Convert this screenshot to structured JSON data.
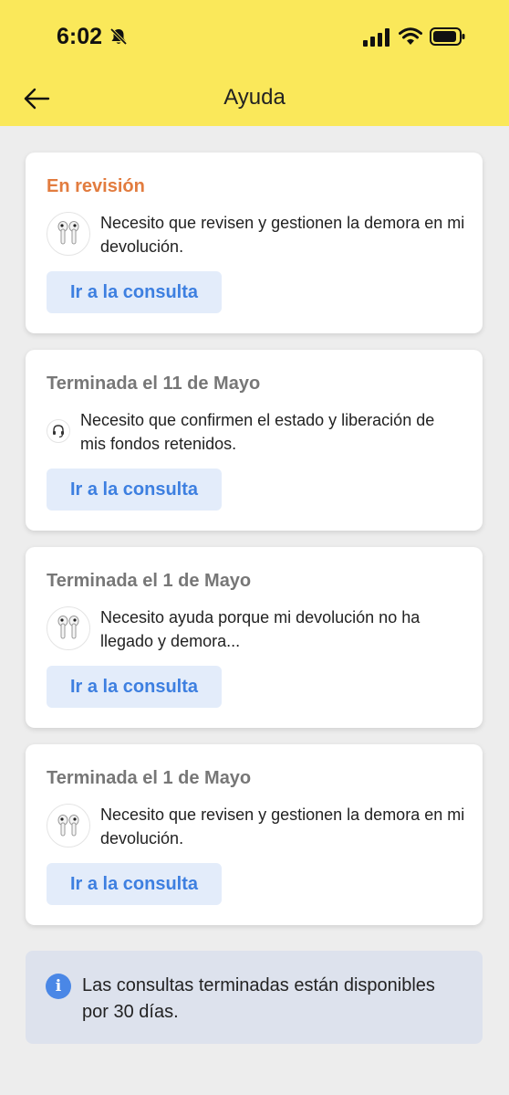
{
  "status_bar": {
    "time": "6:02",
    "icons": [
      "bell-slash-icon",
      "signal-icon",
      "wifi-icon",
      "battery-icon"
    ]
  },
  "header": {
    "title": "Ayuda",
    "back_icon": "arrow-left-icon",
    "background": "#fae85a"
  },
  "cards": [
    {
      "status": "En revisión",
      "status_color": "#e27c3f",
      "icon": "earbuds-icon",
      "description": "Necesito que revisen y gestionen la demora en mi devolución.",
      "button": "Ir a la consulta"
    },
    {
      "status": "Terminada el 11 de Mayo",
      "icon": "headset-icon",
      "description": "Necesito que confirmen el estado y liberación de mis fondos retenidos.",
      "button": "Ir a la consulta"
    },
    {
      "status": "Terminada el 1 de Mayo",
      "icon": "earbuds-icon",
      "description": "Necesito ayuda porque mi devolución no ha llegado y demora...",
      "button": "Ir a la consulta"
    },
    {
      "status": "Terminada el 1 de Mayo",
      "icon": "earbuds-icon",
      "description": "Necesito que revisen y gestionen la demora en mi devolución.",
      "button": "Ir a la consulta"
    }
  ],
  "info": {
    "icon": "info-icon",
    "text": "Las consultas terminadas están disponibles por 30 días.",
    "accent": "#4a87e6"
  }
}
